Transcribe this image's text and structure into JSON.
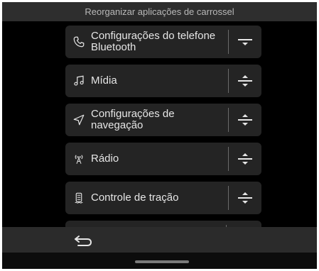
{
  "header": {
    "title": "Reorganizar aplicações de carrossel"
  },
  "items": [
    {
      "label": "Configurações do telefone Bluetooth",
      "icon": "phone-icon",
      "handle_icon": "move-down-icon"
    },
    {
      "label": "Mídia",
      "icon": "music-note-icon",
      "handle_icon": "reorder-icon"
    },
    {
      "label": "Configurações de navegação",
      "icon": "navigation-arrow-icon",
      "handle_icon": "reorder-icon"
    },
    {
      "label": "Rádio",
      "icon": "radio-antenna-icon",
      "handle_icon": "reorder-icon"
    },
    {
      "label": "Controle de tração",
      "icon": "traction-control-icon",
      "handle_icon": "reorder-icon"
    }
  ],
  "footer": {
    "back_icon": "back-arrow-icon"
  },
  "colors": {
    "background": "#000000",
    "card": "#242424",
    "text": "#e6e6e6",
    "title_bar": "#2e2e2e"
  }
}
